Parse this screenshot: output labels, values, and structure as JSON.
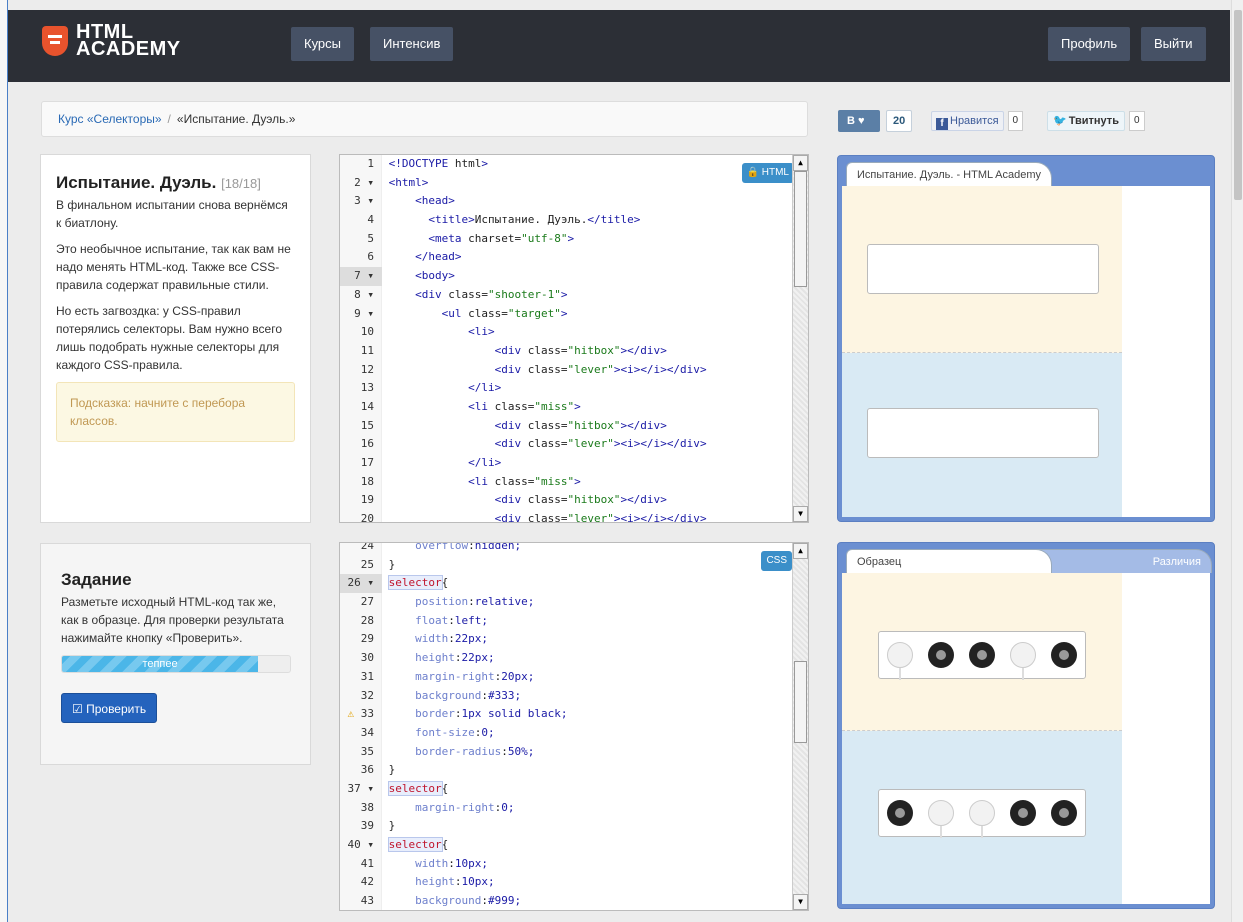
{
  "header": {
    "logo_line1": "HTML",
    "logo_line2": "ACADEMY",
    "nav": [
      "Курсы",
      "Интенсив"
    ],
    "profile": "Профиль",
    "logout": "Выйти"
  },
  "breadcrumb": {
    "course": "Курс «Селекторы»",
    "separator": "/",
    "current": "«Испытание. Дуэль.»"
  },
  "social": {
    "vk_label": "В ♥",
    "vk_count": "20",
    "fb_label": "Нравится",
    "fb_count": "0",
    "tw_label": "Твитнуть",
    "tw_count": "0"
  },
  "info": {
    "title": "Испытание. Дуэль.",
    "step": "[18/18]",
    "p1": "В финальном испытании снова вернёмся к биатлону.",
    "p2": "Это необычное испытание, так как вам не надо менять HTML-код. Также все CSS-правила содержат правильные стили.",
    "p3": "Но есть загвоздка: у CSS-правил потерялись селекторы. Вам нужно всего лишь подобрать нужные селекторы для каждого CSS-правила.",
    "hint": "Подсказка: начните с перебора классов."
  },
  "task": {
    "title": "Задание",
    "text": "Разметьте исходный HTML-код так же, как в образце. Для проверки результата нажимайте кнопку «Проверить».",
    "progress_label": "теппее",
    "progress": 0.86,
    "check_label": "Проверить"
  },
  "html_editor": {
    "badge": "HTML",
    "lines": [
      {
        "n": "1",
        "code": "<!DOCTYPE html>"
      },
      {
        "n": "2 ▾",
        "code": "<html>"
      },
      {
        "n": "3 ▾",
        "code": "    <head>"
      },
      {
        "n": "4",
        "code": "      <title>Испытание. Дуэль.</title>"
      },
      {
        "n": "5",
        "code": "      <meta charset=\"utf-8\">"
      },
      {
        "n": "6",
        "code": "    </head>"
      },
      {
        "n": "7 ▾",
        "code": "    <body>"
      },
      {
        "n": "8 ▾",
        "code": "    <div class=\"shooter-1\">"
      },
      {
        "n": "9 ▾",
        "code": "        <ul class=\"target\">"
      },
      {
        "n": "10",
        "code": "            <li>"
      },
      {
        "n": "11",
        "code": "                <div class=\"hitbox\"></div>"
      },
      {
        "n": "12",
        "code": "                <div class=\"lever\"><i></i></div>"
      },
      {
        "n": "13",
        "code": "            </li>"
      },
      {
        "n": "14",
        "code": "            <li class=\"miss\">"
      },
      {
        "n": "15",
        "code": "                <div class=\"hitbox\"></div>"
      },
      {
        "n": "16",
        "code": "                <div class=\"lever\"><i></i></div>"
      },
      {
        "n": "17",
        "code": "            </li>"
      },
      {
        "n": "18",
        "code": "            <li class=\"miss\">"
      },
      {
        "n": "19",
        "code": "                <div class=\"hitbox\"></div>"
      },
      {
        "n": "20",
        "code": "                <div class=\"lever\"><i></i></div>"
      }
    ]
  },
  "css_editor": {
    "badge": "CSS",
    "lines": [
      {
        "n": "24",
        "code": "    overflow:hidden;"
      },
      {
        "n": "25",
        "code": "}"
      },
      {
        "n": "26 ▾",
        "code": "selector{"
      },
      {
        "n": "27",
        "code": "    position:relative;"
      },
      {
        "n": "28",
        "code": "    float:left;"
      },
      {
        "n": "29",
        "code": "    width:22px;"
      },
      {
        "n": "30",
        "code": "    height:22px;"
      },
      {
        "n": "31",
        "code": "    margin-right:20px;"
      },
      {
        "n": "32",
        "code": "    background:#333;"
      },
      {
        "n": "⚠ 33",
        "code": "    border:1px solid black;"
      },
      {
        "n": "34",
        "code": "    font-size:0;"
      },
      {
        "n": "35",
        "code": "    border-radius:50%;"
      },
      {
        "n": "36",
        "code": "}"
      },
      {
        "n": "37 ▾",
        "code": "selector{"
      },
      {
        "n": "38",
        "code": "    margin-right:0;"
      },
      {
        "n": "39",
        "code": "}"
      },
      {
        "n": "40 ▾",
        "code": "selector{"
      },
      {
        "n": "41",
        "code": "    width:10px;"
      },
      {
        "n": "42",
        "code": "    height:10px;"
      },
      {
        "n": "43",
        "code": "    background:#999;"
      }
    ]
  },
  "preview_top": {
    "tab": "Испытание. Дуэль. - HTML Academy"
  },
  "preview_bottom": {
    "tab_active": "Образец",
    "tab_inactive": "Различия",
    "row1": [
      "miss",
      "hit",
      "hit",
      "miss",
      "hit"
    ],
    "row2": [
      "hit",
      "miss",
      "miss",
      "hit",
      "hit"
    ]
  }
}
